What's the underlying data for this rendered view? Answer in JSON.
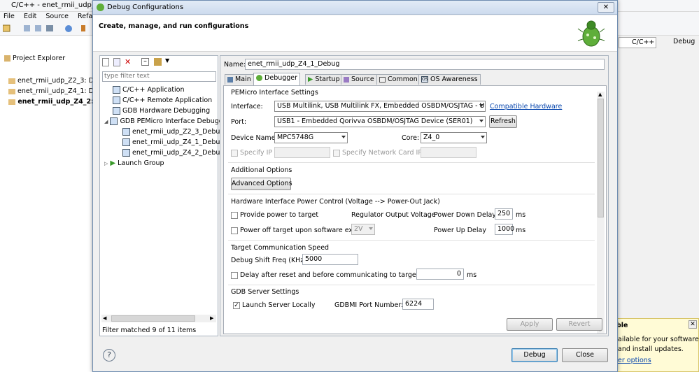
{
  "background": {
    "title": "C/C++ - enet_rmii_udp_Z4...",
    "menu": [
      "File",
      "Edit",
      "Source",
      "Refacto"
    ],
    "project_explorer": "Project Explorer",
    "projects": [
      "enet_rmii_udp_Z2_3: D",
      "enet_rmii_udp_Z4_1: D",
      "enet_rmii_udp_Z4_2:"
    ],
    "perspectives": [
      "C/C++",
      "Debug"
    ],
    "notification": {
      "title": "ble",
      "line1": "ailable for your software.",
      "line2": "and install updates.",
      "link": "er options"
    }
  },
  "dialog": {
    "title": "Debug Configurations",
    "header": "Create, manage, and run configurations",
    "filter_placeholder": "type filter text",
    "tree": [
      {
        "label": "C/C++ Application"
      },
      {
        "label": "C/C++ Remote Application"
      },
      {
        "label": "GDB Hardware Debugging"
      },
      {
        "label": "GDB PEMicro Interface Debugg"
      },
      {
        "label": "enet_rmii_udp_Z2_3_Debug"
      },
      {
        "label": "enet_rmii_udp_Z4_1_Debug"
      },
      {
        "label": "enet_rmii_udp_Z4_2_Debug"
      },
      {
        "label": "Launch Group"
      }
    ],
    "status": "Filter matched 9 of 11 items",
    "name_label": "Name:",
    "name_value": "enet_rmii_udp_Z4_1_Debug",
    "tabs": [
      "Main",
      "Debugger",
      "Startup",
      "Source",
      "Common",
      "OS Awareness"
    ],
    "selected_tab": "Debugger",
    "pemicro": {
      "section": "PEMicro Interface Settings",
      "interface_label": "Interface:",
      "interface_value": "USB Multilink, USB Multilink FX, Embedded OSBDM/OSJTAG - USB",
      "compatible_link": "Compatible Hardware",
      "port_label": "Port:",
      "port_value": "USB1 - Embedded Qorivva OSBDM/OSJTAG Device (SER01)",
      "refresh": "Refresh",
      "device_label": "Device Name:",
      "device_value": "MPC5748G",
      "core_label": "Core:",
      "core_value": "Z4_0",
      "specify_ip": "Specify IP",
      "specify_nc_ip": "Specify Network Card IP"
    },
    "additional": {
      "section": "Additional Options",
      "button": "Advanced Options"
    },
    "power": {
      "section": "Hardware Interface Power Control (Voltage --> Power-Out Jack)",
      "provide_power": "Provide power to target",
      "regulator_label": "Regulator Output Voltage",
      "power_down_label": "Power Down Delay",
      "power_down_value": "250",
      "ms": "ms",
      "power_off": "Power off target upon software exit",
      "voltage_value": "2V",
      "power_up_label": "Power Up Delay",
      "power_up_value": "1000"
    },
    "speed": {
      "section": "Target Communication Speed",
      "shift_label": "Debug Shift Freq (KHz)",
      "shift_value": "5000",
      "delay_label": "Delay after reset and before communicating to target for",
      "delay_value": "0",
      "ms": "ms"
    },
    "gdb": {
      "section": "GDB Server Settings",
      "launch_locally": "Launch Server Locally",
      "port_label": "GDBMI Port Number:",
      "port_value": "6224"
    },
    "buttons": {
      "apply": "Apply",
      "revert": "Revert",
      "debug": "Debug",
      "close": "Close"
    },
    "help": "?"
  }
}
